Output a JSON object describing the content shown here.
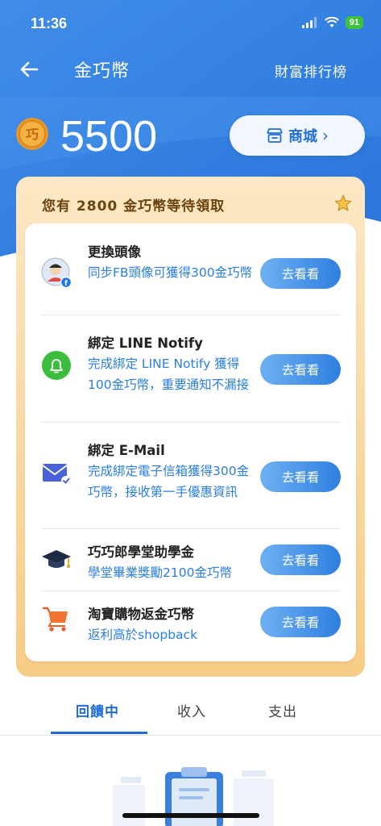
{
  "status": {
    "time": "11:36",
    "battery": "91"
  },
  "nav": {
    "title": "金巧幣",
    "ranking_label": "財富排行榜"
  },
  "wallet": {
    "balance": "5500",
    "shop_label": "商城",
    "shop_chevron": "›"
  },
  "rewards": {
    "heading": "您有 2800 金巧幣等待領取",
    "tasks": [
      {
        "icon": "avatar-facebook-icon",
        "title": "更換頭像",
        "desc": "同步FB頭像可獲得300金巧幣",
        "button": "去看看"
      },
      {
        "icon": "bell-icon",
        "title": "綁定 LINE Notify",
        "desc": "完成綁定 LINE Notify 獲得100金巧幣，重要通知不漏接",
        "button": "去看看"
      },
      {
        "icon": "mail-check-icon",
        "title": "綁定 E-Mail",
        "desc": "完成綁定電子信箱獲得300金巧幣，接收第一手優惠資訊",
        "button": "去看看"
      },
      {
        "icon": "graduation-cap-icon",
        "title": "巧巧郎學堂助學金",
        "desc": "學堂畢業獎勵2100金巧幣",
        "button": "去看看"
      },
      {
        "icon": "shopping-cart-icon",
        "title": "淘寶購物返金巧幣",
        "desc": "返利高於shopback",
        "button": "去看看"
      }
    ]
  },
  "tabs": [
    {
      "label": "回饋中",
      "active": true
    },
    {
      "label": "收入",
      "active": false
    },
    {
      "label": "支出",
      "active": false
    }
  ],
  "colors": {
    "primary": "#1f6ed8",
    "header_blue": "#2f7ce0",
    "accent_gold": "#f6cd86",
    "link_blue": "#2a7fe0"
  }
}
